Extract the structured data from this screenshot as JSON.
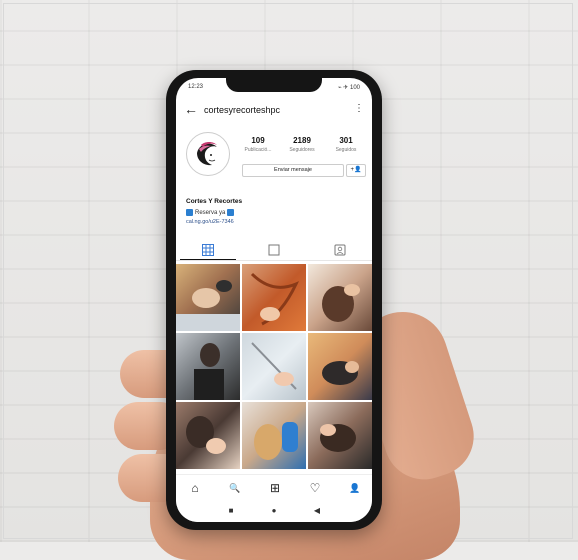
{
  "status": {
    "time": "12:23",
    "icons": "⌁ ✈ 100"
  },
  "profile": {
    "username": "cortesyrecorteshpc",
    "stats": [
      {
        "number": "109",
        "label": "Publicació..."
      },
      {
        "number": "2189",
        "label": "Seguidores"
      },
      {
        "number": "301",
        "label": "Seguidos"
      }
    ],
    "message_button": "Enviar mensaje",
    "follow_icon": "+👤",
    "display_name": "Cortes Y Recortes",
    "bio": "Reserva ya",
    "link": "cal.ng.go/u2E-7346"
  },
  "tabs": {
    "grid_icon": "grid-icon",
    "reels_icon": "reels-icon",
    "tagged_icon": "tagged-icon"
  },
  "photos": [
    "photo-1",
    "photo-2",
    "photo-3",
    "photo-4",
    "photo-5",
    "photo-6",
    "photo-7",
    "photo-8",
    "photo-9"
  ],
  "nav": {
    "home": "⌂",
    "search": "🔍",
    "new_post": "⊞",
    "activity": "♡",
    "profile": "👤"
  },
  "system_nav": {
    "square": "■",
    "home": "●",
    "back": "◀"
  },
  "colors": {
    "phone_frame": "#151515",
    "screen_bg": "#ffffff",
    "link": "#2c4f8a",
    "badge": "#2b7fd0"
  }
}
